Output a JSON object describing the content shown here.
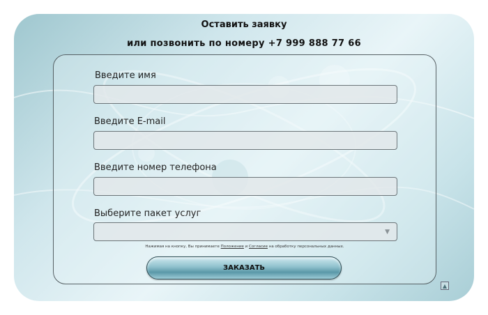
{
  "header": {
    "title": "Оставить заявку",
    "subtitle": "или позвонить по номеру +7 999 888 77 66"
  },
  "form": {
    "name_label": "Введите имя",
    "email_label": "Введите E-mail",
    "phone_label": "Введите номер телефона",
    "package_label": "Выберите пакет услуг",
    "package_selected": "",
    "consent": {
      "prefix": "Нажимая на кнопку, Вы принимаете ",
      "link1": "Положение",
      "middle": " и ",
      "link2": "Согласие",
      "suffix": " на обработку персональных данных."
    },
    "submit_label": "ЗАКАЗАТЬ"
  },
  "icons": {
    "select_arrow": "chevron-down-icon",
    "scroll_up": "arrow-up-icon"
  },
  "colors": {
    "accent": "#5a98a8",
    "panel_bg": "#cfe6ec"
  }
}
